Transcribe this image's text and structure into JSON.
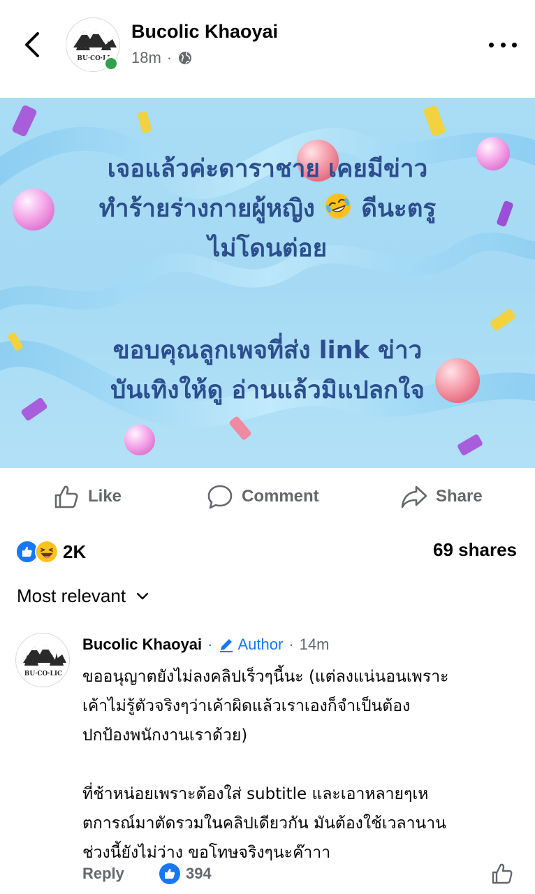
{
  "header": {
    "page_name": "Bucolic Khaoyai",
    "time": "18m",
    "separator": "·",
    "logo_text": "BU·CO·LIC",
    "logo_text_short": "BU·CO·LI"
  },
  "post": {
    "lines_block1": [
      "เจอแล้วค่ะดาราชาย เคยมีข่าว",
      "ทำร้ายร่างกายผู้หญิง",
      "ดีนะตรู",
      "ไม่โดนต่อย"
    ],
    "lines_block2": [
      "ขอบคุณลูกเพจที่ส่ง link ข่าว",
      "บันเทิงให้ดู อ่านแล้วมิแปลกใจ"
    ]
  },
  "actions": {
    "like": "Like",
    "comment": "Comment",
    "share": "Share"
  },
  "stats": {
    "reaction_count": "2K",
    "shares": "69 shares"
  },
  "sort": {
    "label": "Most relevant"
  },
  "comment": {
    "author": "Bucolic Khaoyai",
    "badge": "Author",
    "time": "14m",
    "separator": "·",
    "lines": [
      "ขออนุญาตยังไม่ลงคลิปเร็วๆนี้นะ (แต่ลงแน่นอนเพราะ",
      "เค้าไม่รู้ตัวจริงๆว่าเค้าผิดแล้วเราเองก็จำเป็นต้อง",
      "ปกป้องพนักงานเราด้วย)",
      "ที่ช้าหน่อยเพราะต้องใส่ subtitle และเอาหลายๆเห",
      "ตการณ์มาตัดรวมในคลิปเดียวกัน มันต้องใช้เวลานาน",
      "ช่วงนี้ยังไม่ว่าง ขอโทษจริงๆนะค๊าาา"
    ],
    "reply": "Reply",
    "likes": "394"
  },
  "colors": {
    "brand_blue": "#1877f2",
    "secondary_text": "#65676b",
    "post_text": "#2c4e8e",
    "post_bg": "#a9dcf5",
    "online": "#31a24c"
  }
}
